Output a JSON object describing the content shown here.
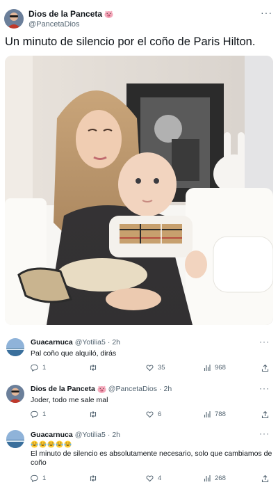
{
  "main_tweet": {
    "author_name": "Dios de la Panceta",
    "author_handle": "@PancetaDios",
    "name_emoji": "pig-face-icon",
    "text": "Un minuto de silencio por el coño de Paris Hilton.",
    "more_label": "···"
  },
  "replies": [
    {
      "author_name": "Guacarnuca",
      "author_handle": "@Yotilia5",
      "separator": "·",
      "time": "2h",
      "text": "Pal coño que alquiló, dirás",
      "stats": {
        "replies": "1",
        "retweets": "",
        "likes": "35",
        "views": "968"
      }
    },
    {
      "author_name": "Dios de la Panceta",
      "author_handle": "@PancetaDios",
      "separator": "·",
      "time": "2h",
      "text": "Joder, todo me sale mal",
      "stats": {
        "replies": "1",
        "retweets": "",
        "likes": "6",
        "views": "788"
      }
    },
    {
      "author_name": "Guacarnuca",
      "author_handle": "@Yotilia5",
      "separator": "·",
      "time": "2h",
      "emoji_count": 5,
      "text": "El minuto de silencio es absolutamente necesario, solo que cambiamos de coño",
      "stats": {
        "replies": "1",
        "retweets": "",
        "likes": "4",
        "views": "268"
      }
    }
  ],
  "more_label": "···",
  "colors": {
    "text": "#0f1419",
    "secondary": "#536471",
    "thread_line": "#cfd9de"
  }
}
